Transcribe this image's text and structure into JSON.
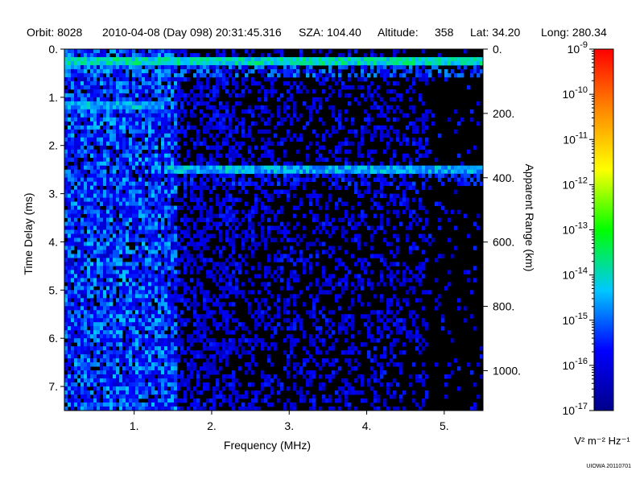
{
  "header": {
    "orbit": "Orbit: 8028",
    "datetime": "2010-04-08 (Day 098) 20:31:45.316",
    "sza": "SZA: 104.40",
    "altitude_label": "Altitude:",
    "altitude_value": "358",
    "lat": "Lat:  34.20",
    "long": "Long: 280.34"
  },
  "credit": "UIOWA 20110701",
  "colors": {
    "background": "#000000",
    "scale": [
      "#00008a",
      "#0000ff",
      "#00c8ff",
      "#00ff00",
      "#ffff00",
      "#ff8800",
      "#ff0000"
    ]
  },
  "chart_data": {
    "type": "heatmap",
    "title": "",
    "xlabel": "Frequency (MHz)",
    "ylabel": "Time Delay (ms)",
    "y2label": "Apparent Range (km)",
    "xlim": [
      0.1,
      5.5
    ],
    "ylim": [
      0,
      7.5
    ],
    "x_ticks": [
      1,
      2,
      3,
      4,
      5
    ],
    "x_tick_labels": [
      "1.",
      "2.",
      "3.",
      "4.",
      "5."
    ],
    "y_ticks": [
      0,
      1,
      2,
      3,
      4,
      5,
      6,
      7
    ],
    "y_tick_labels": [
      "0.",
      "1.",
      "2.",
      "3.",
      "4.",
      "5.",
      "6.",
      "7."
    ],
    "y2_ticks": [
      0,
      200,
      400,
      600,
      800,
      1000
    ],
    "y2_tick_labels": [
      "0.",
      "200.",
      "400.",
      "600.",
      "800.",
      "1000."
    ],
    "y2_range_km": [
      0,
      1124
    ],
    "colorbar": {
      "scale": "log",
      "range": [
        1e-17,
        1e-09
      ],
      "tick_exponents": [
        -9,
        -10,
        -11,
        -12,
        -13,
        -14,
        -15,
        -16,
        -17
      ],
      "tick_base": "10",
      "unit_label": "V² m⁻² Hz⁻¹"
    },
    "features": [
      {
        "kind": "horizontal_echo",
        "delay_ms": 0.25,
        "freq_range_mhz": [
          0.1,
          5.5
        ],
        "level_exp": -14
      },
      {
        "kind": "horizontal_echo",
        "delay_ms": 2.5,
        "freq_range_mhz": [
          1.4,
          5.5
        ],
        "level_exp": -14.5
      },
      {
        "kind": "horizontal_echo",
        "delay_ms": 1.15,
        "freq_range_mhz": [
          0.1,
          1.4
        ],
        "level_exp": -14.5
      },
      {
        "kind": "low_frequency_noise",
        "freq_range_mhz": [
          0.1,
          1.55
        ],
        "delay_range_ms": [
          0,
          7.5
        ],
        "level_exp": -15
      }
    ]
  }
}
